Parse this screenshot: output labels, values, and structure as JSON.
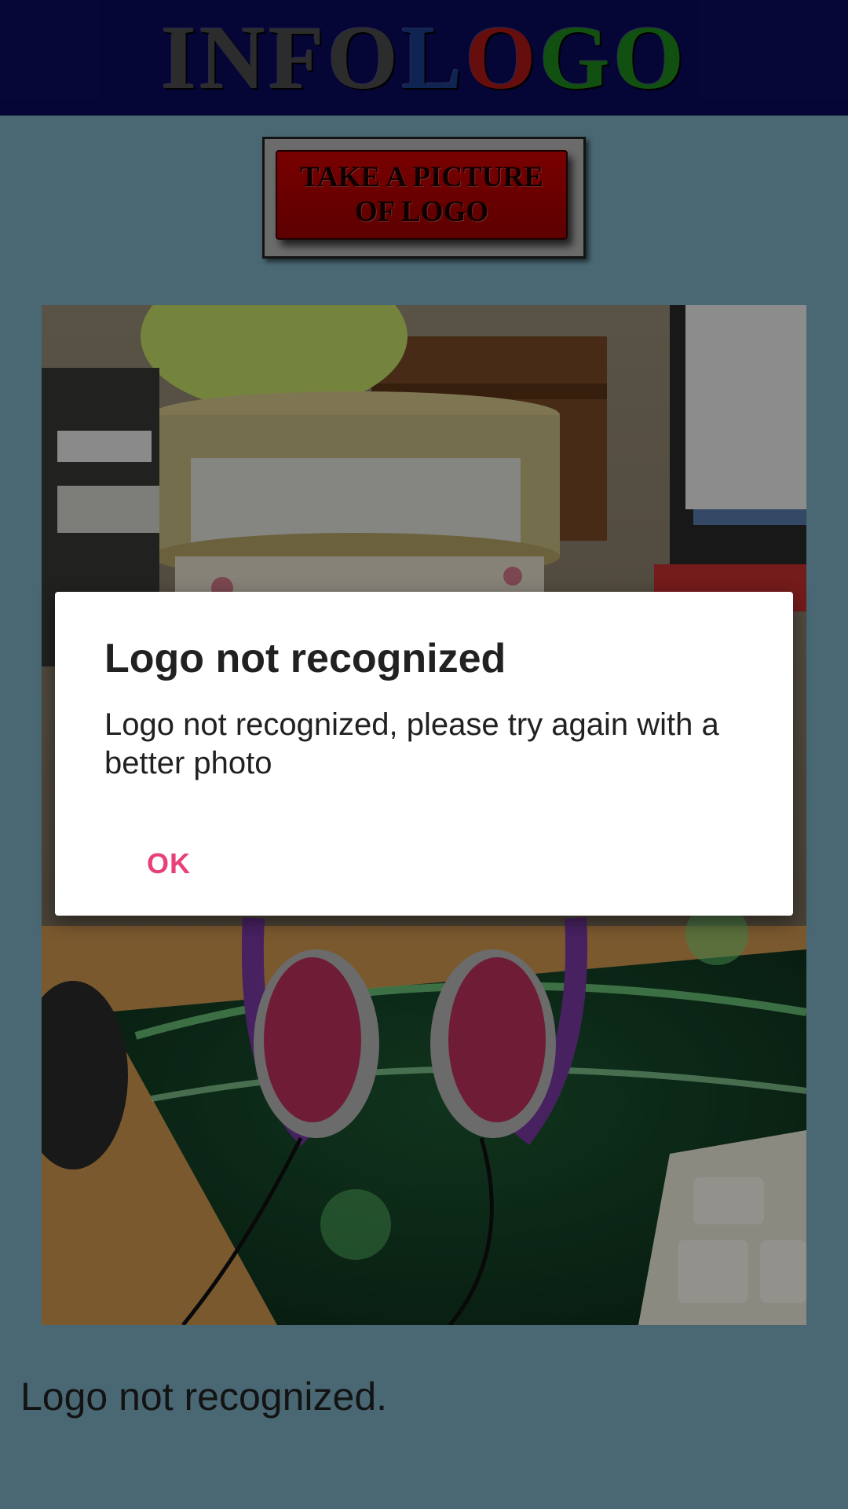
{
  "app": {
    "logo_letters": [
      {
        "char": "I",
        "color": "#4d4d4d"
      },
      {
        "char": "N",
        "color": "#4d4d4d"
      },
      {
        "char": "F",
        "color": "#4d4d4d"
      },
      {
        "char": "O",
        "color": "#4d4d4d"
      },
      {
        "char": "L",
        "color": "#1b3f8f"
      },
      {
        "char": "O",
        "color": "#b01818"
      },
      {
        "char": "G",
        "color": "#1f8a1f"
      },
      {
        "char": "O",
        "color": "#1f8a1f"
      }
    ],
    "header_color": "#0a0a5e",
    "background_color": "#7fb4c8"
  },
  "capture": {
    "button_label_line1": "TAKE A PICTURE",
    "button_label_line2": "OF LOGO"
  },
  "result": {
    "status_text": "Logo not recognized."
  },
  "dialog": {
    "title": "Logo not recognized",
    "message": "Logo not recognized, please try again with a better photo",
    "ok_label": "OK",
    "accent_color": "#e8407a"
  }
}
